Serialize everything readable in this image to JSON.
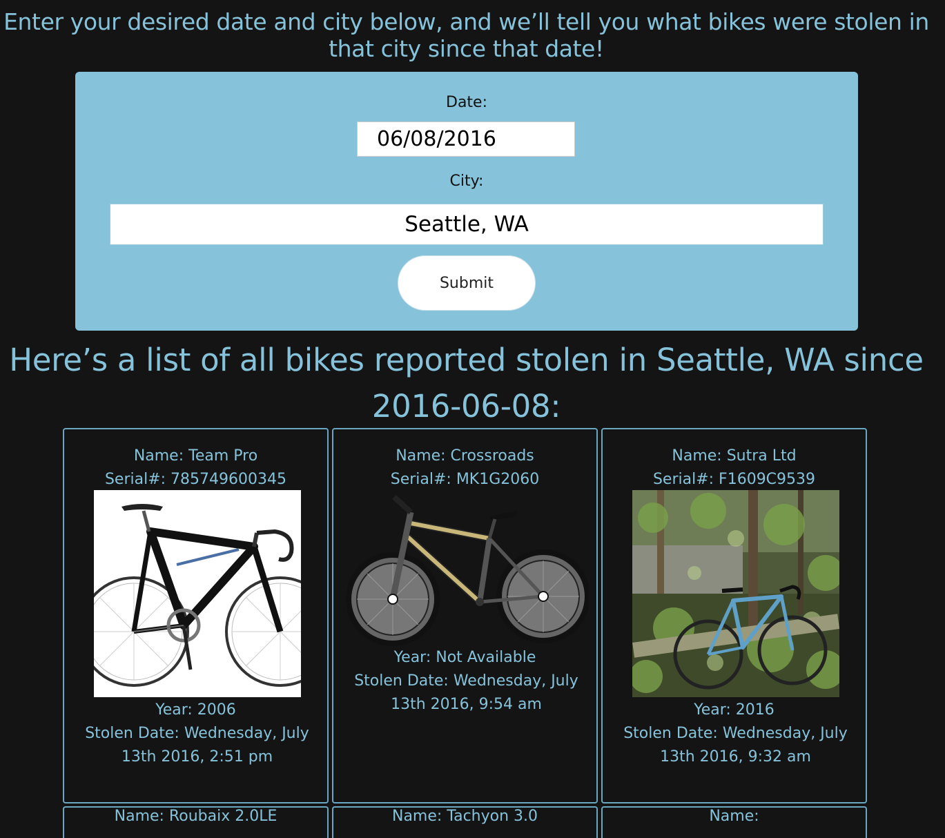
{
  "intro_text": "Enter your desired date and city below, and we’ll tell you what bikes were stolen in that city since that date!",
  "form": {
    "date_label": "Date:",
    "date_value": "06/08/2016",
    "city_label": "City:",
    "city_value": "Seattle, WA",
    "submit_label": "Submit"
  },
  "results_title": "Here’s a list of all bikes reported stolen in Seattle, WA since 2016-06-08:",
  "colors": {
    "background": "#141414",
    "accent_text": "#86c3db",
    "panel": "#86c3da",
    "card_border": "#6aa7c0"
  },
  "bikes": [
    {
      "name": "Name: Team Pro",
      "serial": "Serial#: 785749600345",
      "year": "Year: 2006",
      "stolen": "Stolen Date: Wednesday, July 13th 2016, 2:51 pm",
      "image": "road-bike-photo"
    },
    {
      "name": "Name: Crossroads",
      "serial": "Serial#: MK1G2060",
      "year": "Year: Not Available",
      "stolen": "Stolen Date: Wednesday, July 13th 2016, 9:54 am",
      "image": "bike-illustration"
    },
    {
      "name": "Name: Sutra Ltd",
      "serial": "Serial#: F1609C9539",
      "year": "Year: 2016",
      "stolen": "Stolen Date: Wednesday, July 13th 2016, 9:32 am",
      "image": "bike-in-forest-photo"
    }
  ],
  "bikes_row2": [
    {
      "name": "Name: Roubaix 2.0LE"
    },
    {
      "name": "Name: Tachyon 3.0"
    },
    {
      "name": "Name:"
    }
  ]
}
